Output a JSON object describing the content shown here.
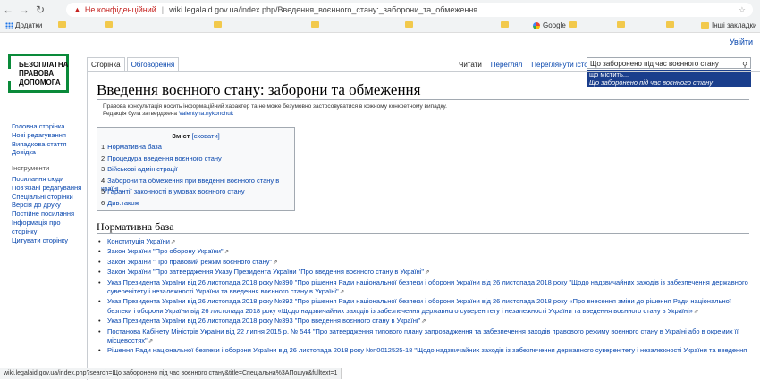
{
  "browser": {
    "security_label": "Не конфіденційний",
    "url": "wiki.legalaid.gov.ua/index.php/Введення_воєнного_стану:_заборони_та_обмеження",
    "bookmarks_label": "Додатки",
    "google_label": "Google",
    "other_bookmarks": "Інші закладки"
  },
  "page": {
    "login": "Увійти",
    "logo_lines": [
      "БЕЗОПЛАТНА",
      "ПРАВОВА",
      "ДОПОМОГА"
    ],
    "tabs": [
      "Сторінка",
      "Обговорення"
    ],
    "right_tabs": [
      "Читати",
      "Переглял",
      "Переглянути історію"
    ],
    "search_value": "Що заборонено під час воєнного стану",
    "suggestions": [
      "що містить...",
      "Що заборонено під час воєнного стану"
    ],
    "title": "Введення воєнного стану: заборони та обмеження",
    "notice_line1": "Правова консультація носить інформаційний характер та не може безумовно застосовуватися в кожному конкретному випадку.",
    "notice_line2_prefix": "Редакція була затверджена ",
    "notice_author": "Valentyna.nykonchuk",
    "toc": {
      "title": "Зміст",
      "hide": "[сховати]",
      "items": [
        {
          "num": "1",
          "label": "Нормативна база"
        },
        {
          "num": "2",
          "label": "Процедура введення воєнного стану"
        },
        {
          "num": "3",
          "label": "Військові адміністрації"
        },
        {
          "num": "4",
          "label": "Заборони та обмеження при введенні воєнного стану в країні"
        },
        {
          "num": "5",
          "label": "Гарантії законності в умовах воєнного стану"
        },
        {
          "num": "6",
          "label": "Див.також"
        }
      ]
    },
    "section_title": "Нормативна база",
    "refs": [
      "Конституція України",
      "Закон України \"Про оборону України\"",
      "Закон України \"Про правовий режим воєнного стану\"",
      "Закон України \"Про затвердження Указу Президента України \"Про введення воєнного стану в Україні\"",
      "Указ Президента України від 26 листопада 2018 року №390 \"Про рішення Ради національної безпеки і оборони України від 26 листопада 2018 року \"Щодо надзвичайних заходів із забезпечення державного суверенітету і незалежності України та введення воєнного стану в Україні\"",
      "Указ Президента України від 26 листопада 2018 року №392 \"Про рішення Ради національної безпеки і оборони України від 26 листопада 2018 року «Про внесення зміни до рішення Ради національної безпеки і оборони України від 26 листопада 2018 року «Щодо надзвичайних заходів із забезпечення державного суверенітету і незалежності України та введення воєнного стану в Україні»",
      "Указ Президента України від 26 листопада 2018 року №393 \"Про введення воєнного стану в Україні\"",
      "Постанова Кабінету Міністрів України від 22 липня 2015 р. № 544 \"Про затвердження типового плану запровадження та забезпечення заходів правового режиму воєнного стану в Україні або в окремих її місцевостях\"",
      "Рішення Ради національної безпеки і оборони України від 26 листопада 2018 року №n0012525-18 \"Щодо надзвичайних заходів із забезпечення державного суверенітету і незалежності України та введення"
    ],
    "sidebar_main": [
      "Головна сторінка",
      "Нові редагування",
      "Випадкова стаття",
      "Довідка"
    ],
    "sidebar_tools_title": "Інструменти",
    "sidebar_tools": [
      "Посилання сюди",
      "Пов'язані редагування",
      "Спеціальні сторінки",
      "Версія до друку",
      "Постійне посилання",
      "Інформація про сторінку",
      "Цитувати сторінку"
    ],
    "status_url": "wiki.legalaid.gov.ua/index.php?search=Що заборонено під час воєнного стану&title=Спеціальна%3AПошук&fulltext=1"
  }
}
